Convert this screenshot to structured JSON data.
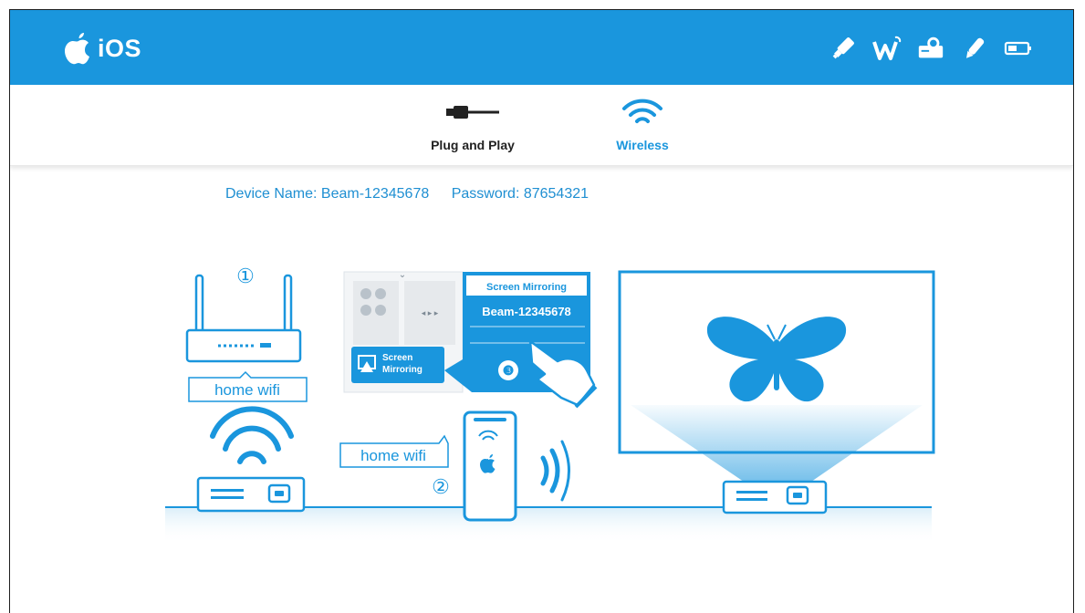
{
  "header": {
    "brand": "iOS",
    "icons": [
      "apple-logo-icon",
      "usb-stick-icon",
      "wifi-w-icon",
      "projector-icon",
      "pen-icon",
      "battery-icon"
    ]
  },
  "modes": {
    "plug": {
      "label": "Plug and Play",
      "icon": "cable-icon"
    },
    "wireless": {
      "label": "Wireless",
      "icon": "wifi-icon",
      "active": true
    }
  },
  "device": {
    "name_text": "Device Name: Beam-12345678",
    "password_text": "Password: 87654321"
  },
  "illustration": {
    "step1": "①",
    "step2": "②",
    "step3": "❸",
    "wifi_label_router": "home wifi",
    "wifi_label_phone": "home wifi",
    "menu_title": "Screen Mirroring",
    "menu_device": "Beam-12345678",
    "mirror_button_line1": "Screen",
    "mirror_button_line2": "Mirroring"
  },
  "colors": {
    "accent": "#1a96dd",
    "accent_light": "#d6ecf8",
    "text_dark": "#222222"
  }
}
